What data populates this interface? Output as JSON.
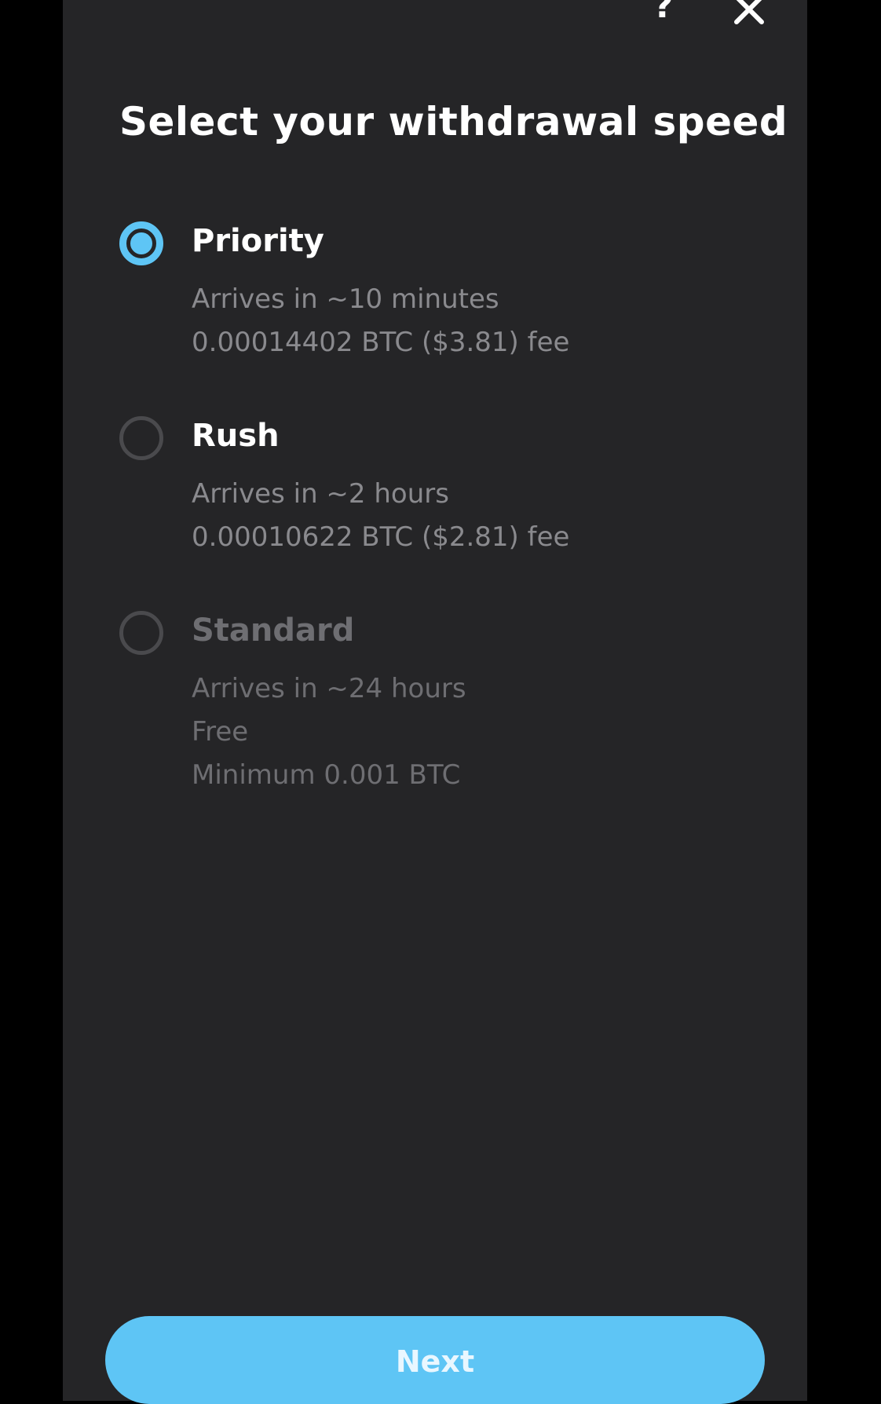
{
  "header": {
    "help_icon": "help-icon",
    "help_glyph": "?",
    "close_icon": "close-icon"
  },
  "title": "Select your withdrawal speed",
  "colors": {
    "accent": "#5ec5f5",
    "background": "#252527",
    "muted_text": "#8a8a8e",
    "disabled_text": "#6e6e72"
  },
  "options": [
    {
      "label": "Priority",
      "selected": true,
      "disabled": false,
      "lines": [
        "Arrives in ~10 minutes",
        "0.00014402 BTC ($3.81) fee"
      ]
    },
    {
      "label": "Rush",
      "selected": false,
      "disabled": false,
      "lines": [
        "Arrives in ~2 hours",
        "0.00010622 BTC ($2.81) fee"
      ]
    },
    {
      "label": "Standard",
      "selected": false,
      "disabled": true,
      "lines": [
        "Arrives in ~24 hours",
        "Free",
        "Minimum 0.001 BTC"
      ]
    }
  ],
  "footer": {
    "next_label": "Next"
  }
}
